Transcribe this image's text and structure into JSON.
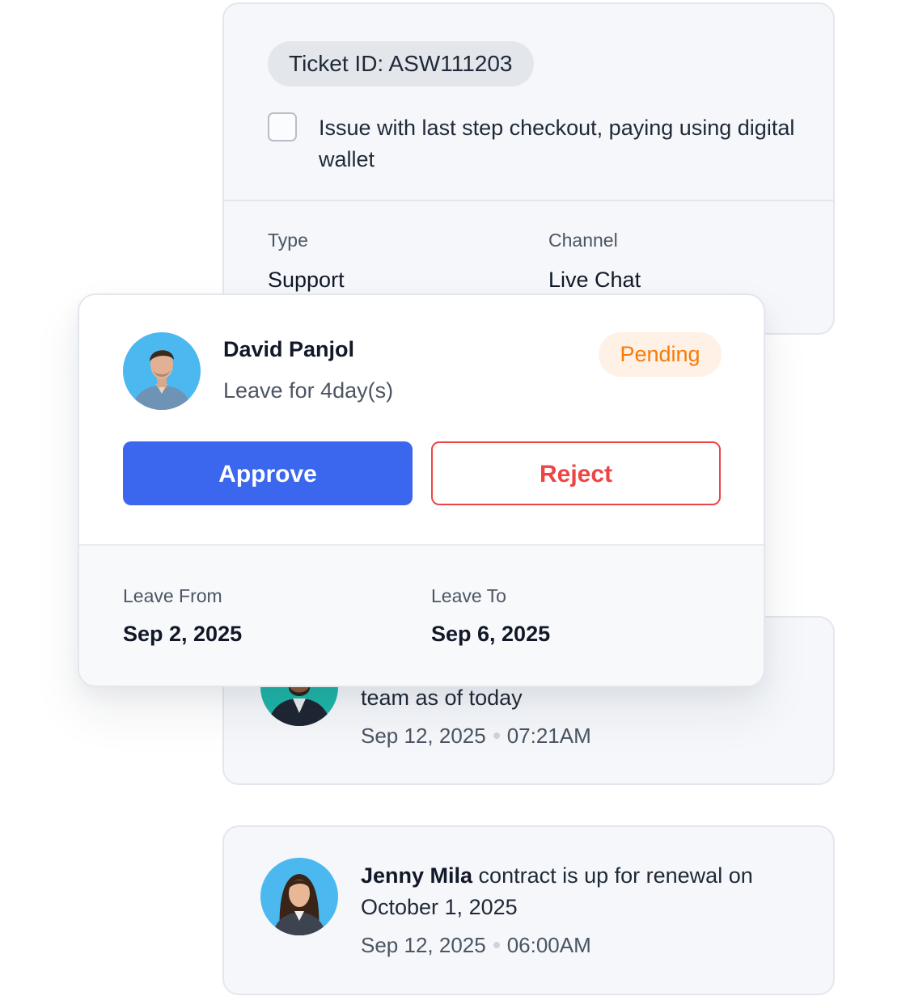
{
  "ticket": {
    "id_label": "Ticket ID: ASW111203",
    "description": "Issue with last step checkout, paying using digital wallet",
    "checked": false,
    "type_label": "Type",
    "type_value": "Support",
    "channel_label": "Channel",
    "channel_value": "Live Chat"
  },
  "leave_request": {
    "name": "David Panjol",
    "subtitle": "Leave for 4day(s)",
    "status": "Pending",
    "approve_label": "Approve",
    "reject_label": "Reject",
    "from_label": "Leave From",
    "from_date": "Sep 2, 2025",
    "to_label": "Leave To",
    "to_date": "Sep 6, 2025"
  },
  "activities": [
    {
      "text": "team as of today",
      "date": "Sep 12, 2025",
      "time": "07:21AM"
    },
    {
      "name": "Jenny Mila",
      "text": " contract is up for renewal on October 1, 2025",
      "date": "Sep 12, 2025",
      "time": "06:00AM"
    }
  ],
  "colors": {
    "primary": "#3b66ee",
    "danger": "#ef4444",
    "pending_text": "#f57c0a",
    "pending_bg": "#fff1e5",
    "avatar_bg": "#4cb8f0",
    "avatar_teal": "#1fb5a8"
  }
}
